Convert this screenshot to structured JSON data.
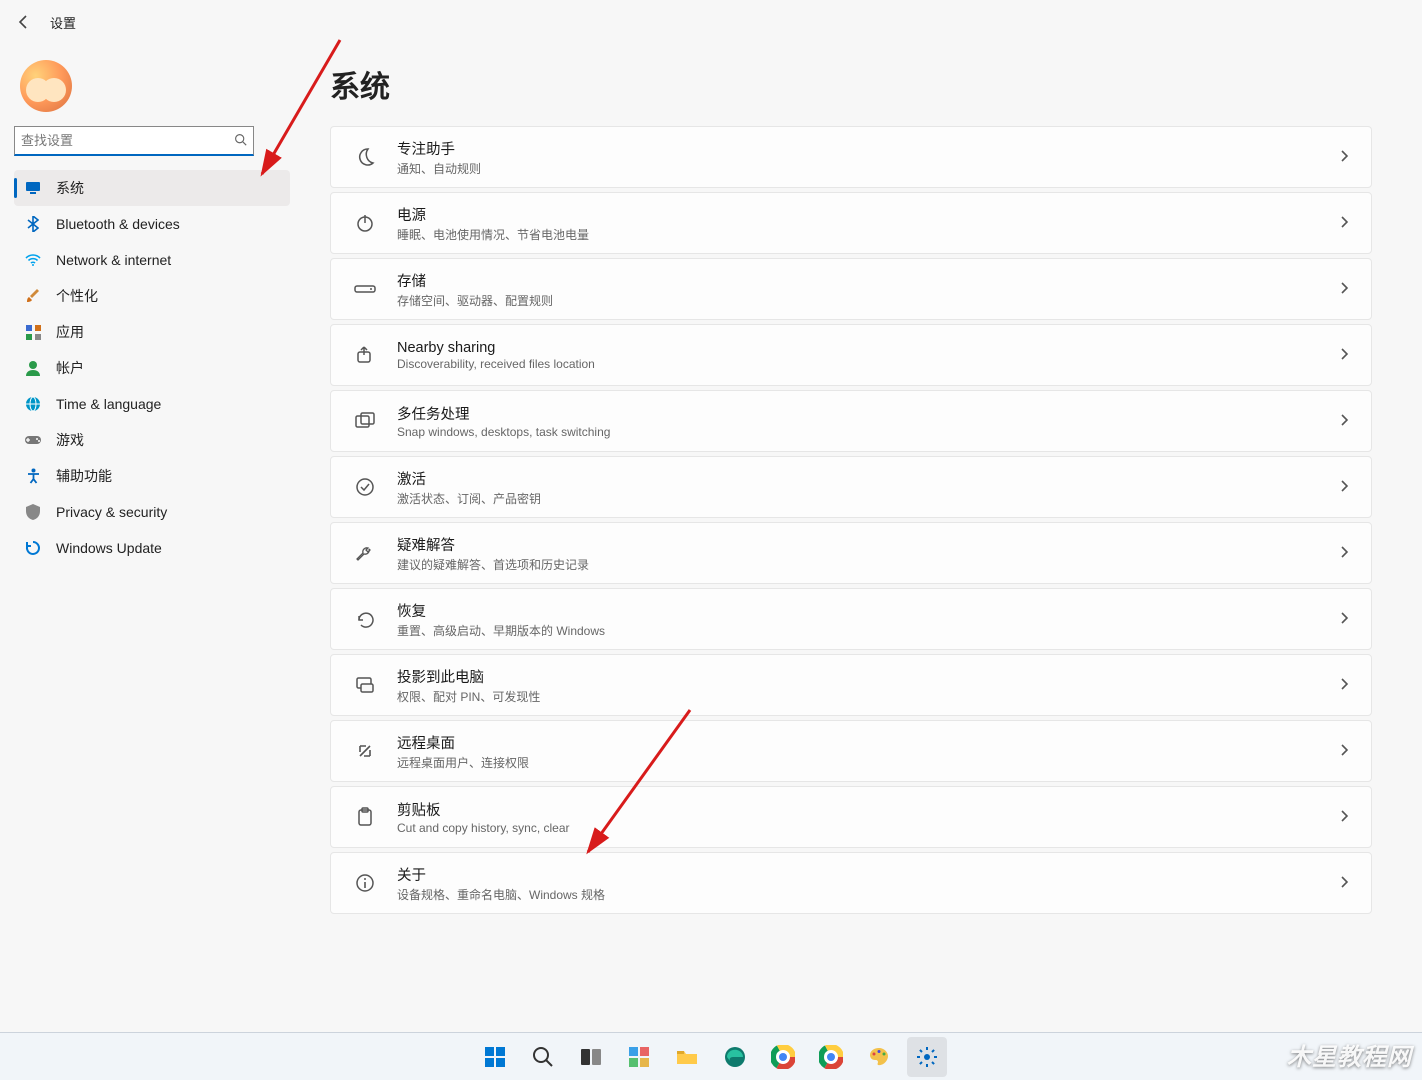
{
  "header": {
    "app_title": "设置"
  },
  "search": {
    "placeholder": "查找设置"
  },
  "sidebar": {
    "items": [
      {
        "label": "系统",
        "icon": "display-icon",
        "color": "#0067c0",
        "active": true
      },
      {
        "label": "Bluetooth & devices",
        "icon": "bluetooth-icon",
        "color": "#0067c0"
      },
      {
        "label": "Network & internet",
        "icon": "wifi-icon",
        "color": "#00a2ed"
      },
      {
        "label": "个性化",
        "icon": "brush-icon",
        "color": "#d08a3a"
      },
      {
        "label": "应用",
        "icon": "apps-icon",
        "color": "#3a6bd0"
      },
      {
        "label": "帐户",
        "icon": "person-icon",
        "color": "#2a9a4a"
      },
      {
        "label": "Time & language",
        "icon": "globe-icon",
        "color": "#0095c7"
      },
      {
        "label": "游戏",
        "icon": "gamepad-icon",
        "color": "#777777"
      },
      {
        "label": "辅助功能",
        "icon": "accessibility-icon",
        "color": "#0067c0"
      },
      {
        "label": "Privacy & security",
        "icon": "shield-icon",
        "color": "#888888"
      },
      {
        "label": "Windows Update",
        "icon": "update-icon",
        "color": "#0078d4"
      }
    ]
  },
  "main": {
    "title": "系统",
    "cards": [
      {
        "title": "专注助手",
        "sub": "通知、自动规则",
        "icon": "moon-icon"
      },
      {
        "title": "电源",
        "sub": "睡眠、电池使用情况、节省电池电量",
        "icon": "power-icon"
      },
      {
        "title": "存储",
        "sub": "存储空间、驱动器、配置规则",
        "icon": "storage-icon"
      },
      {
        "title": "Nearby sharing",
        "sub": "Discoverability, received files location",
        "icon": "share-icon"
      },
      {
        "title": "多任务处理",
        "sub": "Snap windows, desktops, task switching",
        "icon": "multitask-icon"
      },
      {
        "title": "激活",
        "sub": "激活状态、订阅、产品密钥",
        "icon": "check-icon"
      },
      {
        "title": "疑难解答",
        "sub": "建议的疑难解答、首选项和历史记录",
        "icon": "wrench-icon"
      },
      {
        "title": "恢复",
        "sub": "重置、高级启动、早期版本的 Windows",
        "icon": "recovery-icon"
      },
      {
        "title": "投影到此电脑",
        "sub": "权限、配对 PIN、可发现性",
        "icon": "project-icon"
      },
      {
        "title": "远程桌面",
        "sub": "远程桌面用户、连接权限",
        "icon": "remote-icon"
      },
      {
        "title": "剪贴板",
        "sub": "Cut and copy history, sync, clear",
        "icon": "clipboard-icon"
      },
      {
        "title": "关于",
        "sub": "设备规格、重命名电脑、Windows 规格",
        "icon": "info-icon"
      }
    ]
  },
  "watermark": "木星教程网",
  "taskbar": {
    "items": [
      "start",
      "search",
      "taskview",
      "widgets",
      "explorer",
      "edge",
      "chrome",
      "chrome2",
      "paint",
      "settings"
    ]
  }
}
